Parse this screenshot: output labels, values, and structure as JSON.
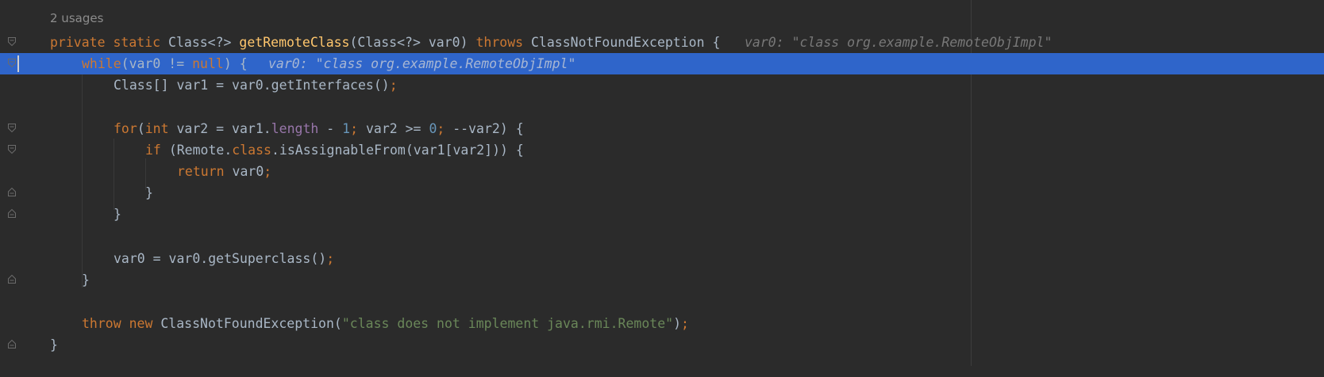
{
  "editor": {
    "usages": "2 usages",
    "lines": {
      "l1": {
        "a": "private static ",
        "b": "Class<?> ",
        "c": "getRemoteClass",
        "d": "(Class<?> var0) ",
        "e": "throws ",
        "f": "ClassNotFoundException {",
        "hint": "var0: \"class org.example.RemoteObjImpl\""
      },
      "l2": {
        "a": "while",
        "b": "(var0 != ",
        "c": "null",
        "d": ") {",
        "hint": "var0: \"class org.example.RemoteObjImpl\""
      },
      "l3": {
        "a": "Class[] var1 = var0.getInterfaces()",
        "b": ";"
      },
      "l5": {
        "a": "for",
        "b": "(",
        "c": "int ",
        "d": "var2 = var1.",
        "e": "length ",
        "f": "- ",
        "g": "1",
        "h": "; ",
        "i": "var2 >= ",
        "j": "0",
        "k": "; ",
        "l": "--var2) {"
      },
      "l6": {
        "a": "if ",
        "b": "(Remote.",
        "c": "class",
        "d": ".isAssignableFrom(var1[var2])) {"
      },
      "l7": {
        "a": "return ",
        "b": "var0",
        "c": ";"
      },
      "l8": {
        "a": "}"
      },
      "l9": {
        "a": "}"
      },
      "l11": {
        "a": "var0 = var0.getSuperclass()",
        "b": ";"
      },
      "l12": {
        "a": "}"
      },
      "l14": {
        "a": "throw ",
        "b": "new ",
        "c": "ClassNotFoundException(",
        "d": "\"class does not implement java.rmi.Remote\"",
        "e": ")",
        "f": ";"
      },
      "l15": {
        "a": "}"
      }
    },
    "icons": [
      "fold-open-icon",
      "fold-close-icon"
    ],
    "colors": {
      "background": "#2b2b2b",
      "current_line": "#2f65ca",
      "keyword": "#cc7832",
      "method": "#ffc66d",
      "number": "#6897bb",
      "field": "#9876aa",
      "string": "#6a8759",
      "text": "#a9b7c6",
      "hint": "#787878"
    }
  }
}
